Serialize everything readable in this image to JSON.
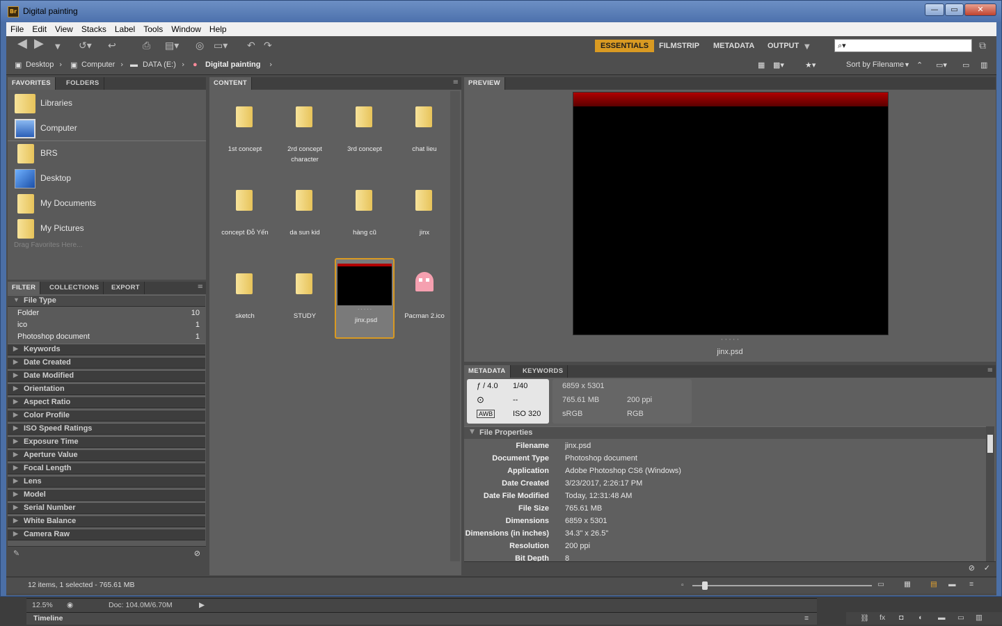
{
  "window": {
    "title": "Digital painting",
    "logo": "Br",
    "min": "—",
    "max": "▭",
    "close": "✕"
  },
  "menu": [
    "File",
    "Edit",
    "View",
    "Stacks",
    "Label",
    "Tools",
    "Window",
    "Help"
  ],
  "workspaces": [
    "ESSENTIALS",
    "FILMSTRIP",
    "METADATA",
    "OUTPUT"
  ],
  "search": {
    "placeholder": ""
  },
  "path": [
    {
      "label": "Desktop",
      "icon": "desktop-icon"
    },
    {
      "label": "Computer",
      "icon": "computer-icon"
    },
    {
      "label": "DATA (E:)",
      "icon": "drive-icon"
    },
    {
      "label": "Digital painting",
      "icon": "ghost-icon"
    }
  ],
  "sort": {
    "label": "Sort by Filename"
  },
  "favorites": {
    "tabs": [
      "FAVORITES",
      "FOLDERS"
    ],
    "items": [
      "Libraries",
      "Computer",
      "BRS",
      "Desktop",
      "My Documents",
      "My Pictures"
    ],
    "hint": "Drag Favorites Here..."
  },
  "filter": {
    "tabs": [
      "FILTER",
      "COLLECTIONS",
      "EXPORT"
    ],
    "file_type": "File Type",
    "rows": [
      {
        "name": "Folder",
        "count": "10"
      },
      {
        "name": "ico",
        "count": "1"
      },
      {
        "name": "Photoshop document",
        "count": "1"
      }
    ],
    "categories": [
      "Keywords",
      "Date Created",
      "Date Modified",
      "Orientation",
      "Aspect Ratio",
      "Color Profile",
      "ISO Speed Ratings",
      "Exposure Time",
      "Aperture Value",
      "Focal Length",
      "Lens",
      "Model",
      "Serial Number",
      "White Balance",
      "Camera Raw"
    ]
  },
  "content": {
    "tab": "CONTENT",
    "items": [
      {
        "label": "1st concept",
        "kind": "folder"
      },
      {
        "label": "2rd concept character",
        "kind": "folder"
      },
      {
        "label": "3rd concept",
        "kind": "folder"
      },
      {
        "label": "chat lieu",
        "kind": "folder"
      },
      {
        "label": "concept Đỗ Yến",
        "kind": "folder"
      },
      {
        "label": "da sun kid",
        "kind": "folder"
      },
      {
        "label": "hàng cũ",
        "kind": "folder"
      },
      {
        "label": "jinx",
        "kind": "folder"
      },
      {
        "label": "sketch",
        "kind": "folder"
      },
      {
        "label": "STUDY",
        "kind": "folder"
      },
      {
        "label": "jinx.psd",
        "kind": "psd",
        "selected": true
      },
      {
        "label": "Pacman 2.ico",
        "kind": "ico"
      }
    ]
  },
  "preview": {
    "tab": "PREVIEW",
    "filename": "jinx.psd",
    "dots": "· · · · ·"
  },
  "metadata": {
    "tabs": [
      "METADATA",
      "KEYWORDS"
    ],
    "camera": {
      "fstop": "ƒ / 4.0",
      "shutter": "1/40",
      "metering": "--",
      "wb": "AWB",
      "iso": "ISO 320"
    },
    "summary": {
      "dims": "6859 x 5301",
      "size": "765.61 MB",
      "res": "200 ppi",
      "profile": "sRGB",
      "mode": "RGB"
    },
    "section": "File Properties",
    "props": [
      {
        "k": "Filename",
        "v": "jinx.psd"
      },
      {
        "k": "Document Type",
        "v": "Photoshop document"
      },
      {
        "k": "Application",
        "v": "Adobe Photoshop CS6 (Windows)"
      },
      {
        "k": "Date Created",
        "v": "3/23/2017, 2:26:17 PM"
      },
      {
        "k": "Date File Modified",
        "v": "Today, 12:31:48 AM"
      },
      {
        "k": "File Size",
        "v": "765.61 MB"
      },
      {
        "k": "Dimensions",
        "v": "6859 x 5301"
      },
      {
        "k": "Dimensions (in inches)",
        "v": "34.3\" x 26.5\""
      },
      {
        "k": "Resolution",
        "v": "200 ppi"
      },
      {
        "k": "Bit Depth",
        "v": "8"
      }
    ]
  },
  "status": {
    "text": "12 items, 1 selected - 765.61 MB"
  },
  "photoshop": {
    "zoom": "12.5%",
    "doc": "Doc: 104.0M/6.70M",
    "timeline": "Timeline"
  }
}
